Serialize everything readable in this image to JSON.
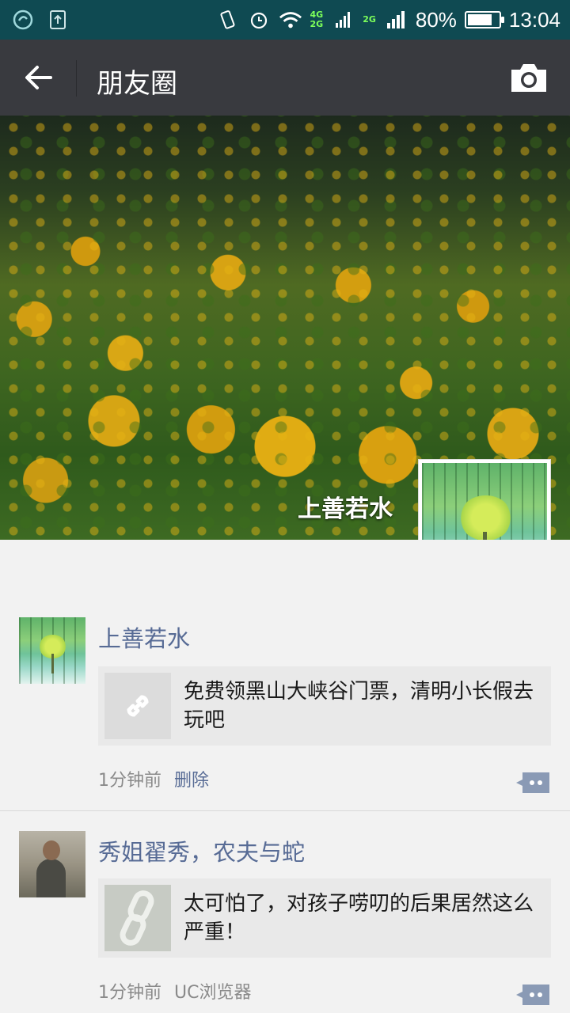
{
  "status_bar": {
    "network_4g": "4G",
    "network_2g_a": "2G",
    "network_2g_b": "2G",
    "battery": "80%",
    "battery_level": 0.8,
    "time": "13:04"
  },
  "nav": {
    "title": "朋友圈"
  },
  "cover": {
    "profile_name": "上善若水"
  },
  "posts": [
    {
      "author": "上善若水",
      "link_title": "免费领黑山大峡谷门票，清明小长假去玩吧",
      "time": "1分钟前",
      "action": "删除"
    },
    {
      "author": "秀姐翟秀，农夫与蛇",
      "link_title": "太可怕了，对孩子唠叨的后果居然这么严重！",
      "time": "1分钟前",
      "source": "UC浏览器"
    }
  ],
  "colors": {
    "status_bar": "#0f4a52",
    "nav_bar": "#393a3f",
    "link_blue": "#576b95",
    "feed_bg": "#f2f2f2"
  }
}
